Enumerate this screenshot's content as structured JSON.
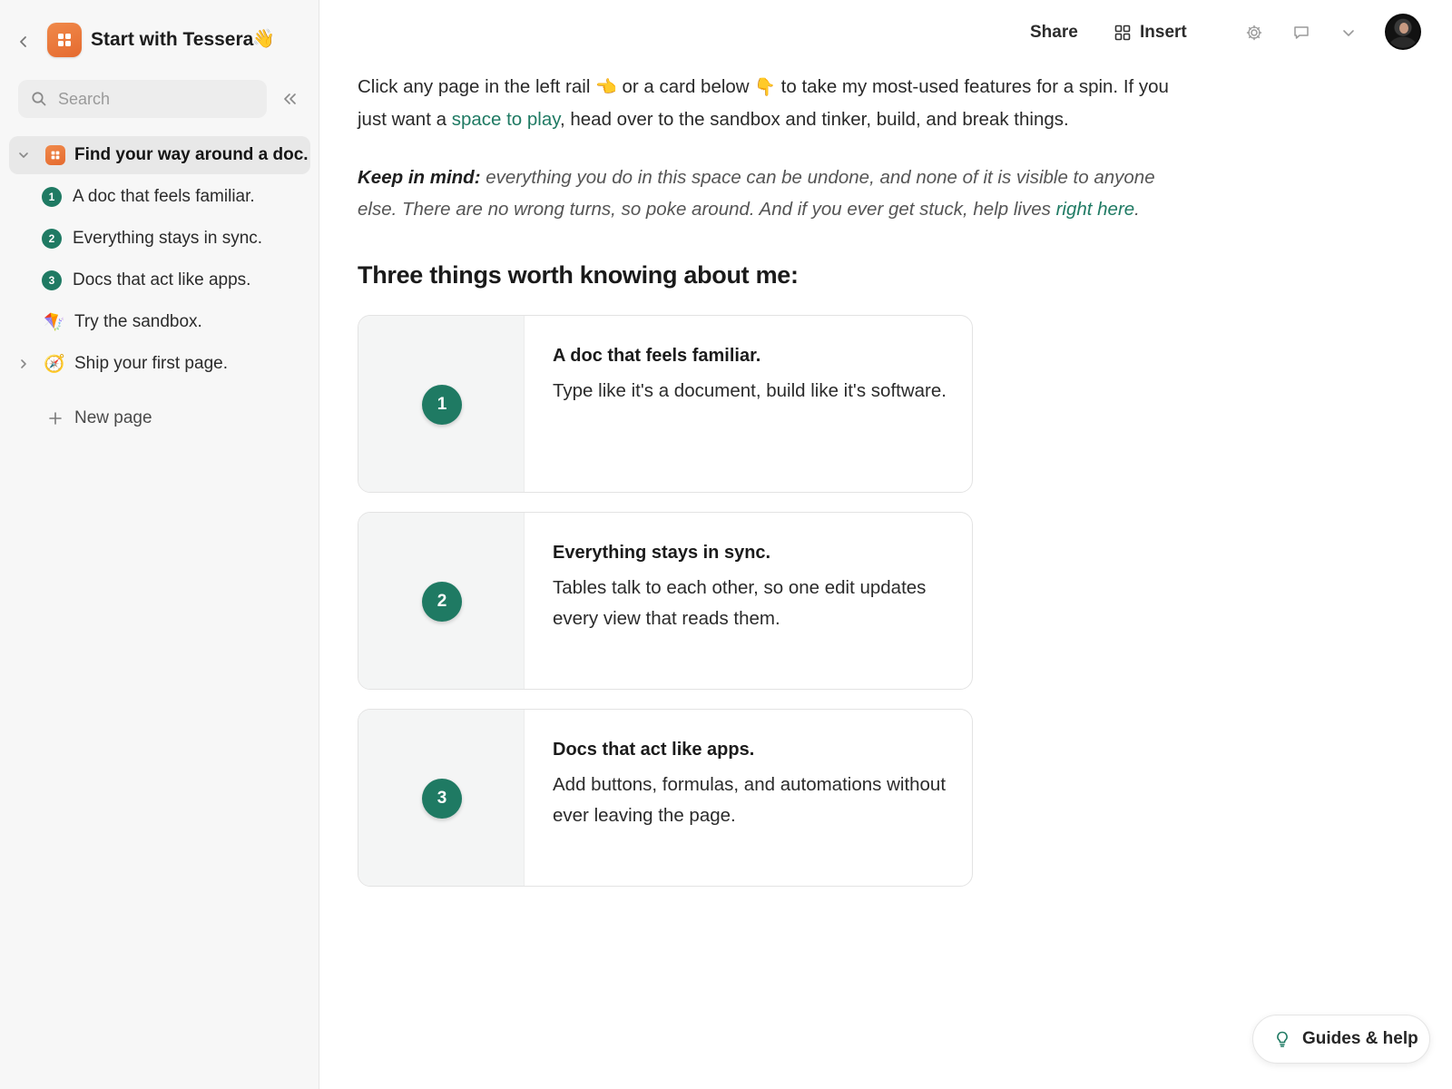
{
  "sidebar": {
    "doc_title": "Start with Tessera",
    "doc_title_emoji": "👋",
    "search": {
      "placeholder": "Search",
      "value": ""
    },
    "items": [
      {
        "label": "Find your way around a doc.",
        "active": true,
        "expanded": true
      },
      {
        "label": "A doc that feels familiar.",
        "badge": "1"
      },
      {
        "label": "Everything stays in sync.",
        "badge": "2"
      },
      {
        "label": "Docs that act like apps.",
        "badge": "3"
      },
      {
        "label": "Try the sandbox.",
        "emoji": "🪁"
      },
      {
        "label": "Ship your first page.",
        "emoji": "🧭"
      }
    ],
    "new_page_label": "New page"
  },
  "topbar": {
    "share_label": "Share",
    "insert_label": "Insert"
  },
  "main": {
    "intro": {
      "part1": "Click any page in the left rail ",
      "emoji1": "👈",
      "part2": " or a card below ",
      "emoji2": "👇",
      "part3": " to take my most-used features for a spin. If you just want a ",
      "link": "space to play",
      "part4": ", head over to the sandbox and tinker, build, and break things."
    },
    "note": {
      "lead": "Keep in mind:",
      "text": " everything you do in this space can be undone, and none of it is visible to anyone else. There are no wrong turns, so poke around. And if you ever get stuck, help lives ",
      "link": "right here",
      "end": "."
    },
    "heading": "Three things worth knowing about me:",
    "cards": [
      {
        "number": "1",
        "title": "A doc that feels familiar.",
        "body": "Type like it's a document, build like it's software."
      },
      {
        "number": "2",
        "title": "Everything stays in sync.",
        "body": "Tables talk to each other, so one edit updates every view that reads them."
      },
      {
        "number": "3",
        "title": "Docs that act like apps.",
        "body": "Add buttons, formulas, and automations without ever leaving the page."
      }
    ]
  },
  "help": {
    "label": "Guides & help"
  },
  "colors": {
    "accent": "#1f7a63",
    "brand": "#e9763a"
  },
  "icons": [
    "chevron-left-icon",
    "app-logo-icon",
    "search-icon",
    "collapse-sidebar-icon",
    "chevron-down-icon",
    "chevron-right-icon",
    "plus-icon",
    "grid-icon",
    "gear-icon",
    "comment-icon",
    "lightbulb-icon"
  ]
}
